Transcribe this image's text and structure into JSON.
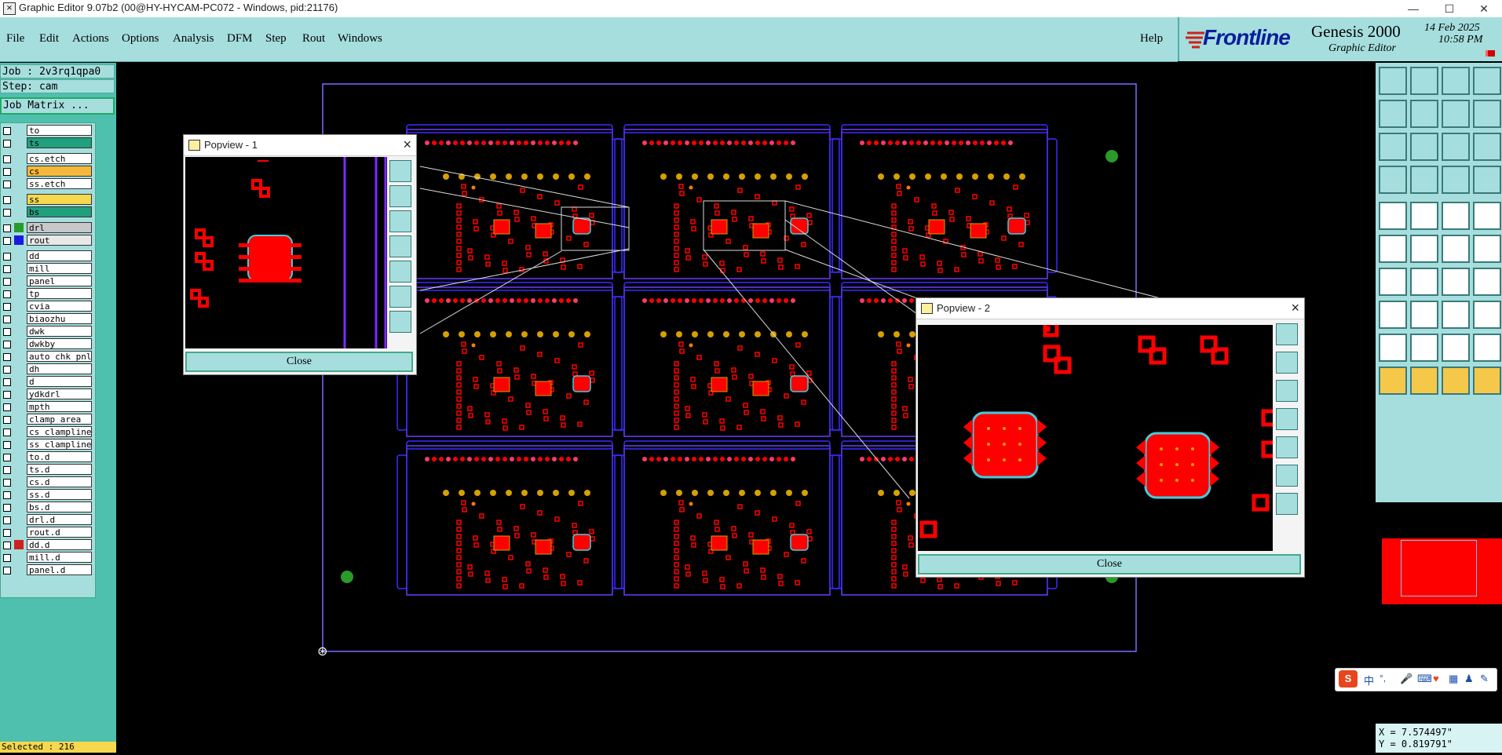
{
  "window": {
    "title": "Graphic Editor 9.07b2 (00@HY-HYCAM-PC072 - Windows, pid:21176)",
    "min": "—",
    "max": "☐",
    "close": "✕"
  },
  "menu": {
    "items": [
      "File",
      "Edit",
      "Actions",
      "Options",
      "Analysis",
      "DFM",
      "Step",
      "Rout",
      "Windows"
    ],
    "help": "Help"
  },
  "brand": {
    "logo": "Frontline",
    "product": "Genesis 2000",
    "subtitle": "Graphic Editor",
    "date": "14 Feb 2025",
    "time": "10:58 PM"
  },
  "job": {
    "job": "Job : 2v3rq1qpa0",
    "step": "Step: cam",
    "matrix_button": "Job Matrix ..."
  },
  "layers": [
    {
      "name": "to",
      "color": "#ffffff"
    },
    {
      "name": "ts",
      "color": "#21a07e"
    },
    {
      "name": "cs.etch",
      "color": "#ffffff"
    },
    {
      "name": "cs",
      "color": "#f6b83a"
    },
    {
      "name": "ss.etch",
      "color": "#ffffff"
    },
    {
      "name": "ss",
      "color": "#f6d84e"
    },
    {
      "name": "bs",
      "color": "#21a07e"
    },
    {
      "name": "drl",
      "color": "#c8c8c8",
      "mark": "#2a9a2a"
    },
    {
      "name": "rout",
      "color": "#e8e8e8",
      "mark": "#1a1adf"
    },
    {
      "name": "dd",
      "color": "#ffffff"
    },
    {
      "name": "mill",
      "color": "#ffffff"
    },
    {
      "name": "panel",
      "color": "#ffffff"
    },
    {
      "name": "tp",
      "color": "#ffffff"
    },
    {
      "name": "cvia",
      "color": "#ffffff"
    },
    {
      "name": "biaozhu",
      "color": "#ffffff"
    },
    {
      "name": "dwk",
      "color": "#ffffff"
    },
    {
      "name": "dwkby",
      "color": "#ffffff"
    },
    {
      "name": "auto_chk_pnl",
      "color": "#ffffff"
    },
    {
      "name": "dh",
      "color": "#ffffff"
    },
    {
      "name": "d",
      "color": "#ffffff"
    },
    {
      "name": "ydkdrl",
      "color": "#ffffff"
    },
    {
      "name": "mpth",
      "color": "#ffffff"
    },
    {
      "name": "clamp_area",
      "color": "#ffffff"
    },
    {
      "name": "cs_clampline",
      "color": "#ffffff"
    },
    {
      "name": "ss_clampline",
      "color": "#ffffff"
    },
    {
      "name": "to.d",
      "color": "#ffffff"
    },
    {
      "name": "ts.d",
      "color": "#ffffff"
    },
    {
      "name": "cs.d",
      "color": "#ffffff"
    },
    {
      "name": "ss.d",
      "color": "#ffffff"
    },
    {
      "name": "bs.d",
      "color": "#ffffff"
    },
    {
      "name": "drl.d",
      "color": "#ffffff"
    },
    {
      "name": "rout.d",
      "color": "#ffffff"
    },
    {
      "name": "dd.d",
      "color": "#ffffff",
      "mark": "#cc2222"
    },
    {
      "name": "mill.d",
      "color": "#ffffff"
    },
    {
      "name": "panel.d",
      "color": "#ffffff"
    }
  ],
  "status": {
    "selected": "Selected : 216",
    "x": "X = 7.574497\"",
    "y": "Y = 0.819791\""
  },
  "popup1": {
    "title": "Popview - 1",
    "close": "Close"
  },
  "popup2": {
    "title": "Popview - 2",
    "close": "Close"
  },
  "ime": {
    "zh": "中",
    "dots": "°,"
  },
  "colors": {
    "panel_bg": "#a6dede",
    "accent_green": "#4fbfae",
    "pad_red": "#ff1a1a",
    "outline_blue": "#5a3cff"
  }
}
